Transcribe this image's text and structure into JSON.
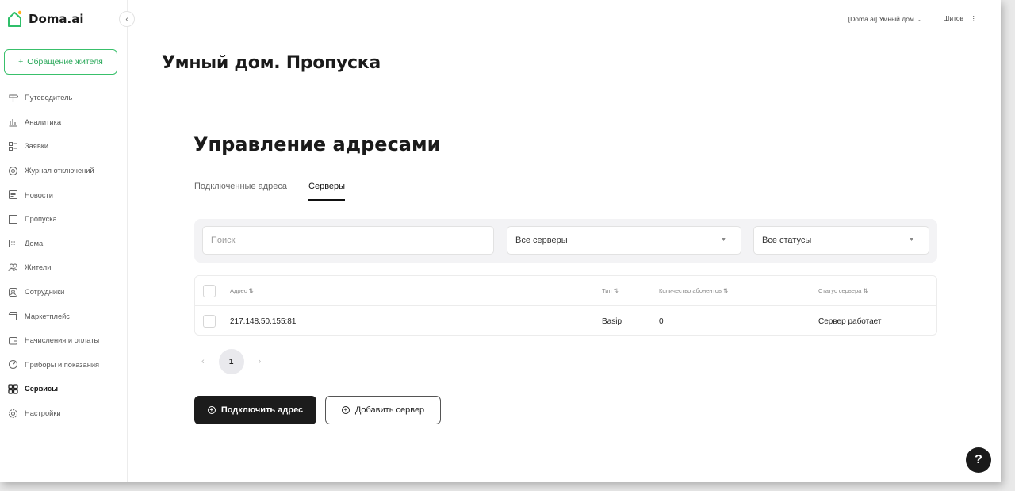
{
  "app": {
    "logo_text": "Doma.ai",
    "collapse_icon": "chevron-left-icon"
  },
  "sidebar": {
    "appeal_label": "Обращение жителя",
    "items": [
      {
        "label": "Путеводитель",
        "icon": "signpost-icon"
      },
      {
        "label": "Аналитика",
        "icon": "chart-icon"
      },
      {
        "label": "Заявки",
        "icon": "list-icon"
      },
      {
        "label": "Журнал отключений",
        "icon": "outage-icon"
      },
      {
        "label": "Новости",
        "icon": "news-icon"
      },
      {
        "label": "Пропуска",
        "icon": "pass-icon"
      },
      {
        "label": "Дома",
        "icon": "building-icon"
      },
      {
        "label": "Жители",
        "icon": "users-icon"
      },
      {
        "label": "Сотрудники",
        "icon": "employee-icon"
      },
      {
        "label": "Маркетплейс",
        "icon": "store-icon"
      },
      {
        "label": "Начисления и оплаты",
        "icon": "wallet-icon"
      },
      {
        "label": "Приборы и показания",
        "icon": "meter-icon"
      },
      {
        "label": "Сервисы",
        "icon": "grid-icon",
        "active": true
      },
      {
        "label": "Настройки",
        "icon": "gear-icon"
      }
    ]
  },
  "topbar": {
    "organization": "[Doma.ai] Умный дом",
    "user": "Шитов"
  },
  "main": {
    "page_title": "Умный дом. Пропуска",
    "section_title": "Управление адресами",
    "tabs": [
      {
        "label": "Подключенные адреса",
        "active": false
      },
      {
        "label": "Серверы",
        "active": true
      }
    ],
    "filters": {
      "search_placeholder": "Поиск",
      "servers_value": "Все серверы",
      "status_value": "Все статусы"
    },
    "table": {
      "columns": [
        "Адрес ⇅",
        "Тип ⇅",
        "Количество абонентов ⇅",
        "Статус сервера ⇅"
      ],
      "rows": [
        {
          "address": "217.148.50.155:81",
          "type": "Basip",
          "subscribers": "0",
          "status": "Сервер работает"
        }
      ]
    },
    "pagination": {
      "prev": "‹",
      "current": "1",
      "next": "›"
    },
    "buttons": {
      "connect_address": "Подключить адрес",
      "add_server": "Добавить сервер"
    },
    "help_label": "?"
  },
  "colors": {
    "accent_green": "#39c06b",
    "primary_dark": "#1c1c1c"
  }
}
